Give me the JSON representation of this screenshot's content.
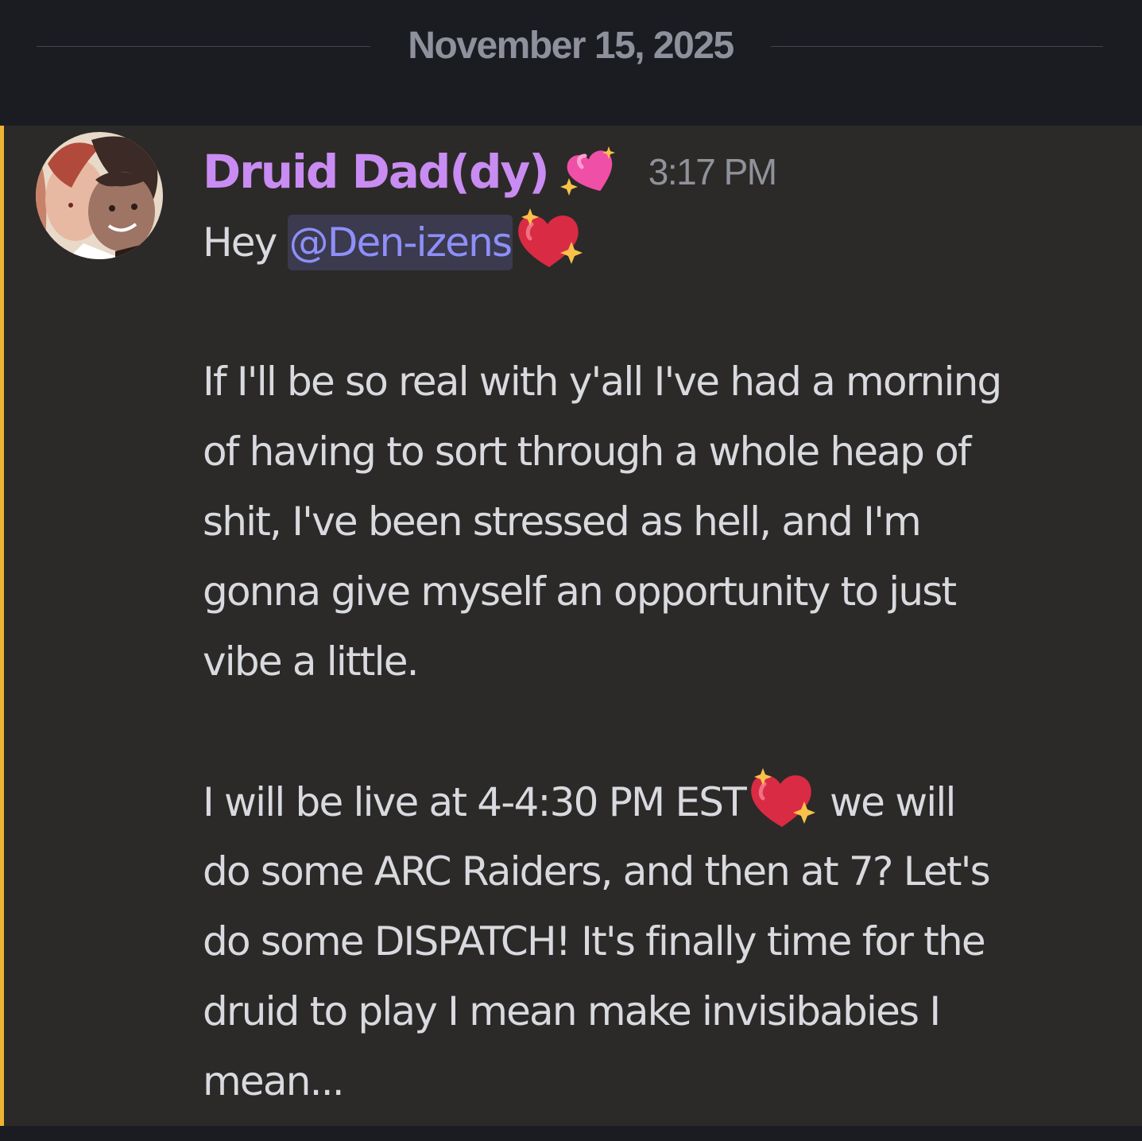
{
  "date_divider": "November 15, 2025",
  "message": {
    "author": "Druid Dad(dy)",
    "author_emoji": "sparkling-heart-icon",
    "timestamp": "3:17 PM",
    "greeting": "Hey",
    "mention": "@Den-izens",
    "greeting_emoji": "heart-on-fire-sparkles-icon",
    "paragraph1_lines": [
      "If I'll be so real with y'all I've had a morning",
      "of having to sort through a whole heap of",
      "shit, I've been stressed as hell, and I'm",
      "gonna give myself an opportunity to just",
      "vibe a little."
    ],
    "paragraph2_line1_before": "I will be live at 4-4:30 PM EST",
    "paragraph2_line1_after": "we will",
    "paragraph2_lines": [
      "do some ARC Raiders, and then at 7? Let's",
      "do some DISPATCH! It's finally time for the",
      "druid to play I mean make invisibabies I",
      "mean..."
    ]
  },
  "colors": {
    "background": "#1b1c22",
    "message_highlight": "#2c2a28",
    "highlight_bar": "#f0b232",
    "username": "#c98cf2",
    "mention_text": "#8e8ff8",
    "mention_bg": "#3b3a4f",
    "body_text": "#d9dadf",
    "muted_text": "#8f929b"
  }
}
